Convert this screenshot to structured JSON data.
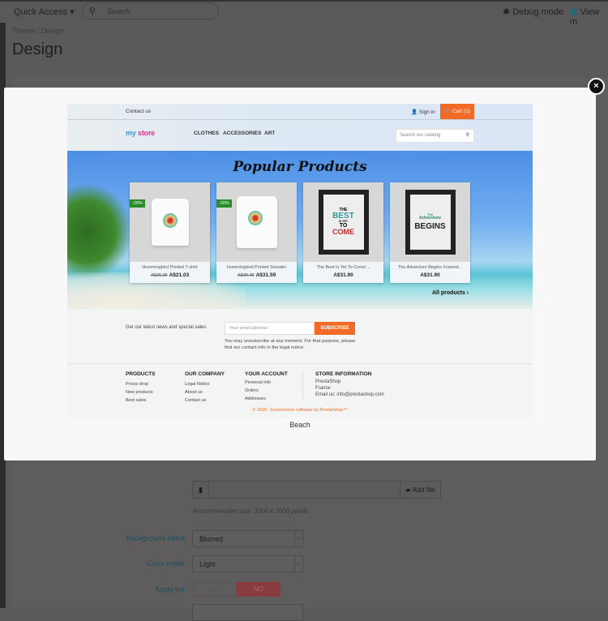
{
  "topbar": {
    "quick_access": "Quick Access ▾",
    "search_placeholder": "Search",
    "debug": "Debug mode",
    "view": "View m"
  },
  "breadcrumb": {
    "parent": "Theme",
    "sep": "/",
    "current": "Design"
  },
  "page_title": "Design",
  "modal": {
    "close": "×",
    "caption": "Beach",
    "preview": {
      "contact": "Contact us",
      "signin": "Sign in",
      "cart": "Cart (1)",
      "logo_a": "my ",
      "logo_b": "store",
      "nav": [
        "CLOTHES",
        "ACCESSORIES",
        "ART"
      ],
      "search_placeholder": "Search our catalog",
      "section_title": "Popular Products",
      "products": [
        {
          "name": "Hummingbird Printed T-shirt",
          "old_price": "A$26.29",
          "price": "A$21.03",
          "badge": "-20%"
        },
        {
          "name": "Hummingbird Printed Sweater",
          "old_price": "A$39.49",
          "price": "A$31.59",
          "badge": "-20%"
        },
        {
          "name": "The Best Is Yet To Come'...",
          "price": "A$31.90",
          "art": [
            "THE",
            "BEST",
            "IS YET",
            "TO",
            "COME"
          ]
        },
        {
          "name": "The Adventure Begins Framed...",
          "price": "A$31.90",
          "art": [
            "The",
            "Adventure",
            "BEGINS"
          ]
        }
      ],
      "all_products": "All products ›",
      "newsletter": {
        "text": "Get our latest news and special sales",
        "placeholder": "Your email address",
        "button": "SUBSCRIBE",
        "note": "You may unsubscribe at any moment. For that purpose, please find our contact info in the legal notice."
      },
      "footer": {
        "products": {
          "title": "PRODUCTS",
          "links": [
            "Prices drop",
            "New products",
            "Best sales"
          ]
        },
        "company": {
          "title": "OUR COMPANY",
          "links": [
            "Legal Notice",
            "About us",
            "Contact us"
          ]
        },
        "account": {
          "title": "YOUR ACCOUNT",
          "links": [
            "Personal info",
            "Orders",
            "Addresses"
          ]
        },
        "store": {
          "title": "STORE INFORMATION",
          "lines": [
            "PrestaShop",
            "France",
            "Email us: info@prestashop.com"
          ]
        },
        "copyright": "© 2018 - Ecommerce software by PrestaShop™"
      }
    }
  },
  "form": {
    "add_file": "Add file",
    "hint": "Recommended size: 3000 x 2000 pixels",
    "bg_effect": {
      "label": "Background effect",
      "value": "Blurred"
    },
    "color_mode": {
      "label": "Color mode",
      "value": "Light"
    },
    "tint": {
      "label": "Apply tint",
      "yes": "YES",
      "no": "NO"
    }
  },
  "colors": {
    "accent": "#f16b26",
    "badge": "#2a8d2a"
  }
}
